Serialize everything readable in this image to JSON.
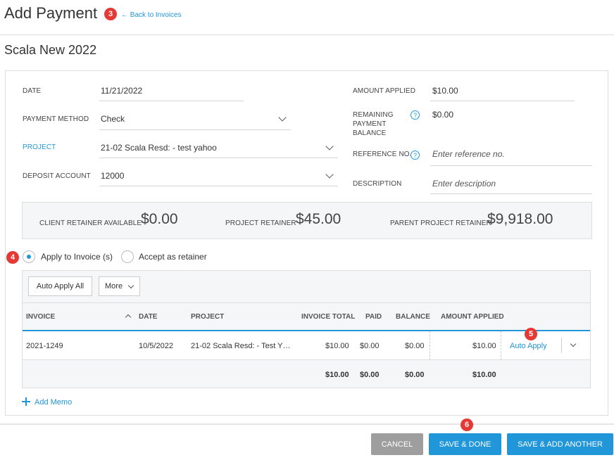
{
  "header": {
    "title": "Add Payment",
    "back_link": "← Back to Invoices",
    "badge_3": "3"
  },
  "client_name": "Scala New 2022",
  "form": {
    "date_label": "DATE",
    "date_value": "11/21/2022",
    "payment_method_label": "PAYMENT METHOD",
    "payment_method_value": "Check",
    "project_label": "PROJECT",
    "project_value": "21-02 Scala Resd: - test yahoo",
    "deposit_account_label": "DEPOSIT ACCOUNT",
    "deposit_account_value": "12000",
    "amount_applied_label": "AMOUNT APPLIED",
    "amount_applied_value": "$10.00",
    "remaining_label_1": "REMAINING",
    "remaining_label_2": "PAYMENT",
    "remaining_label_3": "BALANCE",
    "remaining_value": "$0.00",
    "reference_label": "REFERENCE NO.",
    "reference_placeholder": "Enter reference no.",
    "description_label": "DESCRIPTION",
    "description_placeholder": "Enter description",
    "help_glyph": "?"
  },
  "retainers": {
    "client_label": "CLIENT RETAINER AVAILABLE",
    "client_value": "$0.00",
    "project_label": "PROJECT RETAINER",
    "project_value": "$45.00",
    "parent_label": "PARENT PROJECT RETAINER",
    "parent_value": "$9,918.00"
  },
  "apply_options": {
    "badge_4": "4",
    "apply_to_invoice": "Apply to Invoice (s)",
    "accept_retainer": "Accept as retainer",
    "selected": "apply_to_invoice"
  },
  "table": {
    "auto_apply_all": "Auto Apply All",
    "more": "More",
    "columns": {
      "invoice": "INVOICE",
      "date": "DATE",
      "project": "PROJECT",
      "invoice_total": "INVOICE TOTAL",
      "paid": "PAID",
      "balance": "BALANCE",
      "amount_applied": "AMOUNT APPLIED"
    },
    "rows": [
      {
        "invoice": "2021-1249",
        "date": "10/5/2022",
        "project": "21-02 Scala Resd: - Test Y…",
        "invoice_total": "$10.00",
        "paid": "$0.00",
        "balance": "$0.00",
        "amount_applied": "$10.00",
        "action": "Auto Apply"
      }
    ],
    "badge_5": "5",
    "totals": {
      "invoice_total": "$10.00",
      "paid": "$0.00",
      "balance": "$0.00",
      "amount_applied": "$10.00"
    }
  },
  "add_memo": "Add Memo",
  "footer": {
    "badge_6": "6",
    "cancel": "CANCEL",
    "save_done": "SAVE & DONE",
    "save_add_another": "SAVE & ADD ANOTHER"
  },
  "colors": {
    "accent": "#2196d8",
    "cancel_bg": "#9e9e9e",
    "badge": "#e53935"
  }
}
